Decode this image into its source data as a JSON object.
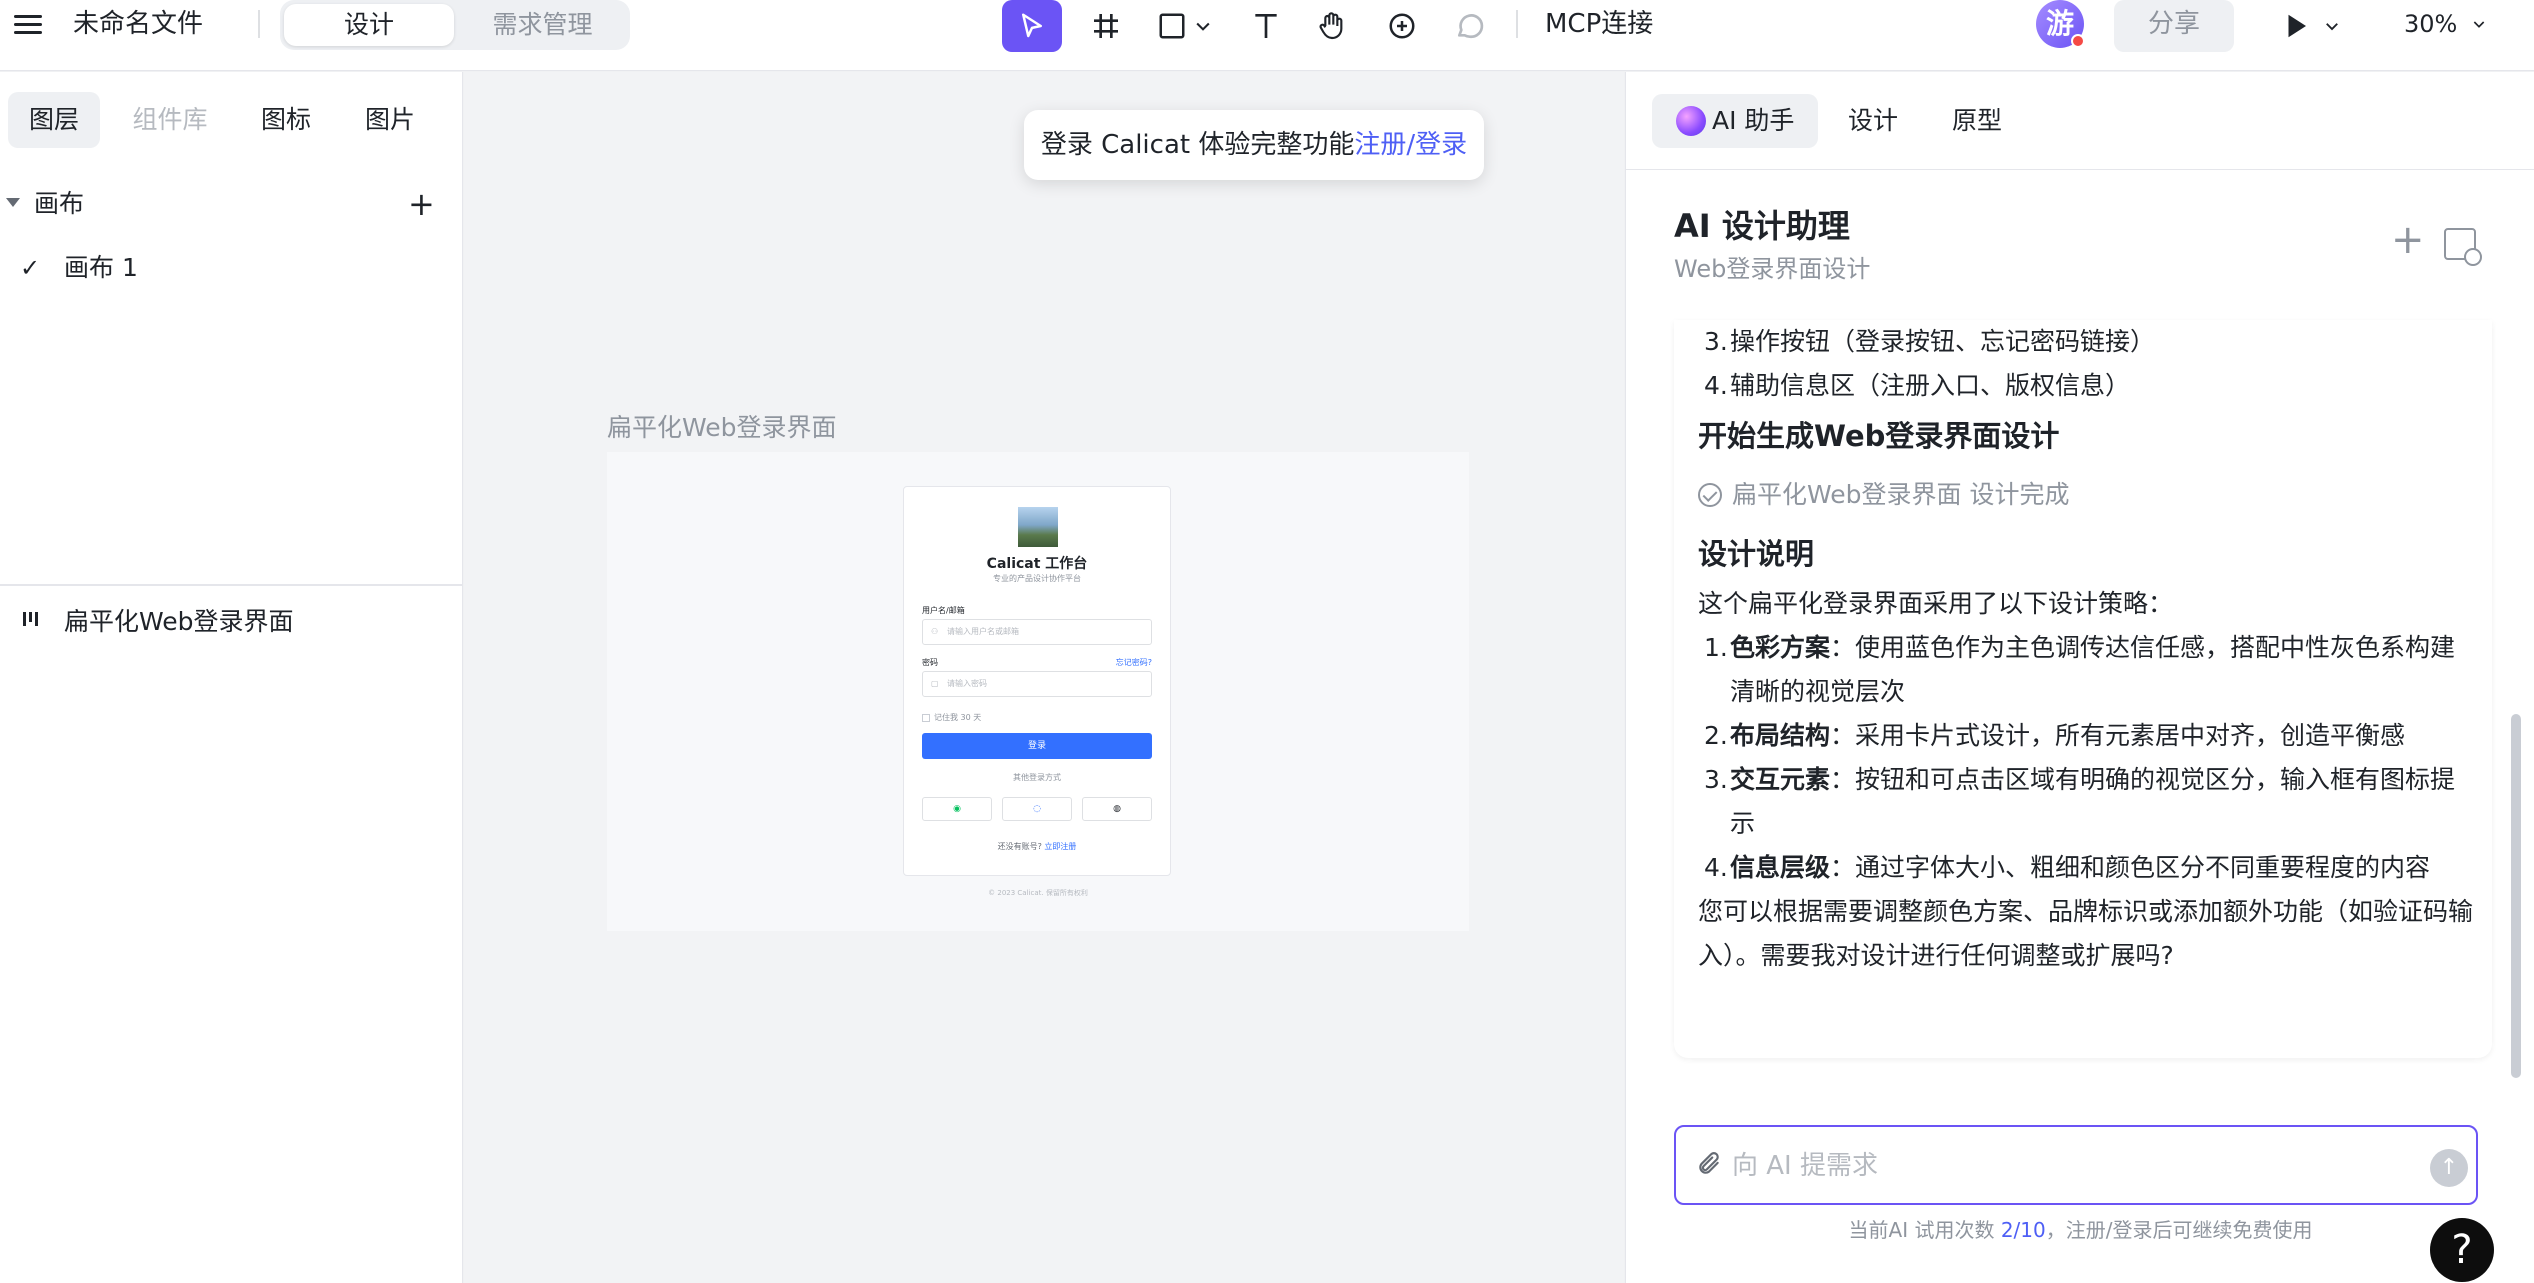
{
  "header": {
    "file_title": "未命名文件",
    "mode_tabs": [
      "设计",
      "需求管理"
    ],
    "mcp_label": "MCP连接",
    "avatar_letter": "游",
    "share_label": "分享",
    "zoom": "30%"
  },
  "tools": [
    "select-arrow",
    "frame-hash",
    "rectangle",
    "text-T",
    "hand",
    "component",
    "comment"
  ],
  "left_panel": {
    "tabs": [
      "图层",
      "组件库",
      "图标",
      "图片"
    ],
    "section_label": "画布",
    "canvas_item": "画布 1",
    "layer_item": "扁平化Web登录界面"
  },
  "canvas": {
    "banner_text": "登录 Calicat 体验完整功能",
    "banner_link": "注册/登录",
    "frame_title": "扁平化Web登录界面",
    "login_card": {
      "title": "Calicat 工作台",
      "subtitle": "专业的产品设计协作平台",
      "username_label": "用户名/邮箱",
      "username_placeholder": "请输入用户名或邮箱",
      "password_label": "密码",
      "forgot": "忘记密码?",
      "password_placeholder": "请输入密码",
      "remember": "记住我 30 天",
      "login_button": "登录",
      "other_login": "其他登录方式",
      "register_text": "还没有账号?",
      "register_link": "立即注册",
      "copyright": "© 2023 Calicat. 保留所有权利"
    }
  },
  "right_panel": {
    "tabs": [
      "AI 助手",
      "设计",
      "原型"
    ],
    "title": "AI 设计助理",
    "subtitle": "Web登录界面设计",
    "chat": {
      "list_items": [
        {
          "num": "3.",
          "text": "操作按钮（登录按钮、忘记密码链接）"
        },
        {
          "num": "4.",
          "text": "辅助信息区（注册入口、版权信息）"
        }
      ],
      "heading1": "开始生成Web登录界面设计",
      "done_text": "扁平化Web登录界面 设计完成",
      "heading2": "设计说明",
      "intro": "这个扁平化登录界面采用了以下设计策略：",
      "points": [
        {
          "num": "1.",
          "bold": "色彩方案",
          "text": "：使用蓝色作为主色调传达信任感，搭配中性灰色系构建清晰的视觉层次"
        },
        {
          "num": "2.",
          "bold": "布局结构",
          "text": "：采用卡片式设计，所有元素居中对齐，创造平衡感"
        },
        {
          "num": "3.",
          "bold": "交互元素",
          "text": "：按钮和可点击区域有明确的视觉区分，输入框有图标提示"
        },
        {
          "num": "4.",
          "bold": "信息层级",
          "text": "：通过字体大小、粗细和颜色区分不同重要程度的内容"
        }
      ],
      "closing": "您可以根据需要调整颜色方案、品牌标识或添加额外功能（如验证码输入）。需要我对设计进行任何调整或扩展吗?"
    },
    "input_placeholder": "向 AI 提需求",
    "quota_prefix": "当前AI 试用次数 ",
    "quota_count": "2/10",
    "quota_suffix": "，注册/登录后可继续免费使用"
  },
  "help_label": "?",
  "colors": {
    "accent": "#6b54f5",
    "link": "#4e5ff5",
    "login_blue": "#3370ff"
  }
}
